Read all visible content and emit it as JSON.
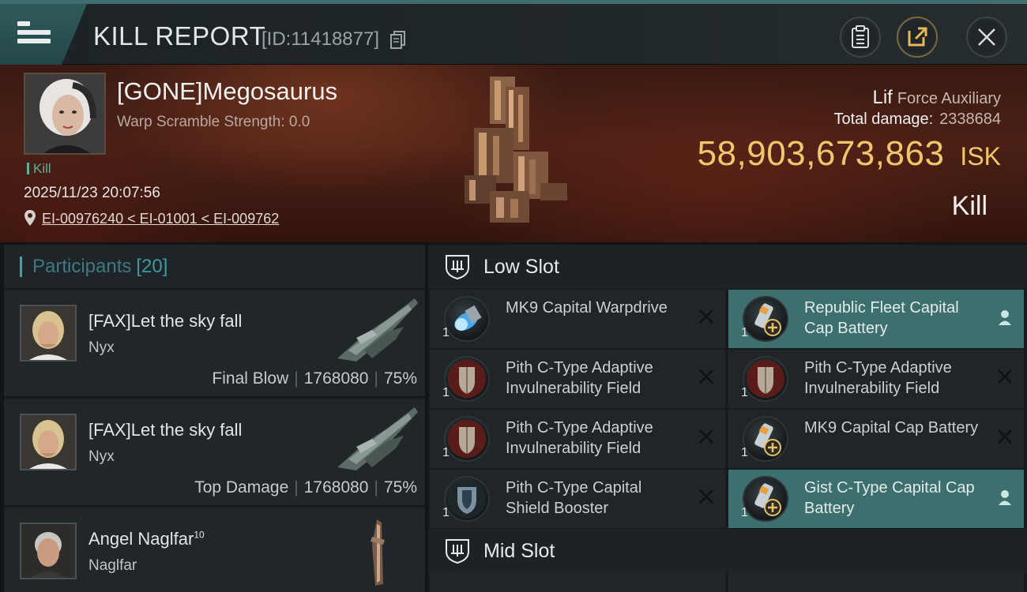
{
  "header": {
    "title": "KILL REPORT",
    "report_id": "[ID:11418877]"
  },
  "victim": {
    "name": "[GONE]Megosaurus",
    "warp_scramble": "Warp Scramble Strength: 0.0",
    "tag": "Kill",
    "timestamp": "2025/11/23 20:07:56",
    "location": "EI-00976240 < EI-01001 < EI-009762"
  },
  "ship": {
    "name": "Lif",
    "class": "Force Auxiliary",
    "total_damage_label": "Total damage:",
    "total_damage": "2338684",
    "isk_value": "58,903,673,863",
    "isk_unit": "ISK",
    "outcome": "Kill"
  },
  "participants": {
    "title": "Participants",
    "count": "[20]",
    "items": [
      {
        "name": "[FAX]Let the sky fall",
        "ship": "Nyx",
        "role": "Final Blow",
        "damage": "1768080",
        "percent": "75%"
      },
      {
        "name": "[FAX]Let the sky fall",
        "ship": "Nyx",
        "role": "Top Damage",
        "damage": "1768080",
        "percent": "75%"
      },
      {
        "name": "Angel Naglfar",
        "level": "10",
        "ship": "Naglfar"
      }
    ]
  },
  "low_slot": {
    "title": "Low Slot",
    "modules": [
      {
        "name": "MK9 Capital Warpdrive",
        "qty": "1",
        "status": "destroyed",
        "icon": "warpdrive-icon"
      },
      {
        "name": "Republic Fleet Capital Cap Battery",
        "qty": "1",
        "status": "dropped",
        "icon": "cap-battery-icon"
      },
      {
        "name": "Pith C-Type Adaptive Invulnerability Field",
        "qty": "1",
        "status": "destroyed",
        "icon": "invuln-field-icon"
      },
      {
        "name": "Pith C-Type Adaptive Invulnerability Field",
        "qty": "1",
        "status": "destroyed",
        "icon": "invuln-field-icon"
      },
      {
        "name": "Pith C-Type Adaptive Invulnerability Field",
        "qty": "1",
        "status": "destroyed",
        "icon": "invuln-field-icon"
      },
      {
        "name": "MK9 Capital Cap Battery",
        "qty": "1",
        "status": "destroyed",
        "icon": "cap-battery-icon"
      },
      {
        "name": "Pith C-Type Capital Shield Booster",
        "qty": "1",
        "status": "destroyed",
        "icon": "shield-booster-icon"
      },
      {
        "name": "Gist C-Type Capital Cap Battery",
        "qty": "1",
        "status": "dropped",
        "icon": "cap-battery-icon"
      }
    ]
  },
  "mid_slot": {
    "title": "Mid Slot"
  },
  "colors": {
    "accent_teal": "#3c6f6d",
    "isk_gold": "#f2c66c",
    "kill_green": "#5fb09a"
  }
}
